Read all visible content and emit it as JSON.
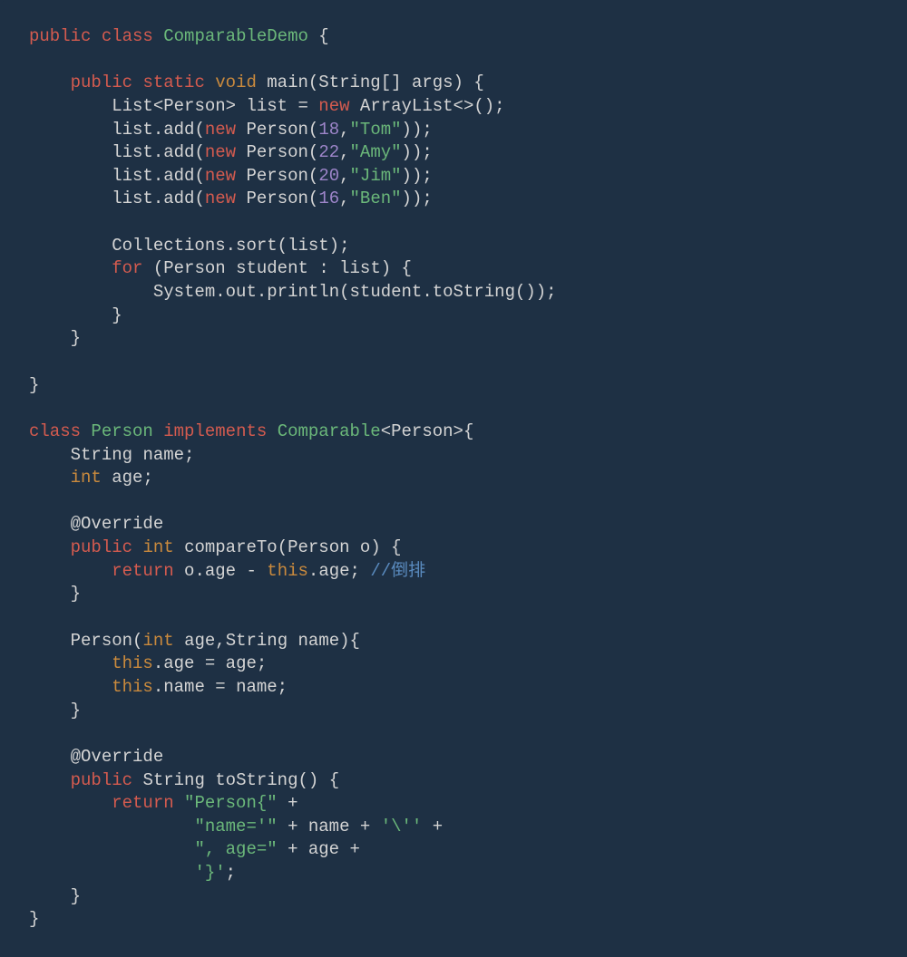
{
  "tokens": {
    "public": "public",
    "class": "class",
    "static": "static",
    "void": "void",
    "int": "int",
    "new": "new",
    "for": "for",
    "return": "return",
    "this": "this",
    "implements": "implements",
    "ComparableDemo": "ComparableDemo",
    "Comparable": "Comparable",
    "Person": "Person",
    "main": "main",
    "String": "String",
    "args": "args",
    "List": "List",
    "list": "list",
    "ArrayList": "ArrayList",
    "add": "add",
    "Collections": "Collections",
    "sort": "sort",
    "student": "student",
    "System": "System",
    "out": "out",
    "println": "println",
    "toString": "toString",
    "name": "name",
    "age": "age",
    "Override": "@Override",
    "compareTo": "compareTo",
    "o": "o",
    "comment_daopai": "//倒排"
  },
  "numbers": {
    "n18": "18",
    "n22": "22",
    "n20": "20",
    "n16": "16"
  },
  "strings": {
    "Tom": "\"Tom\"",
    "Amy": "\"Amy\"",
    "Jim": "\"Jim\"",
    "Ben": "\"Ben\"",
    "PersonOpen": "\"Person{\"",
    "nameEq": "\"name='\"",
    "backslashQuote": "'\\''",
    "ageEq": "\", age=\"",
    "closeBrace": "'}'"
  }
}
